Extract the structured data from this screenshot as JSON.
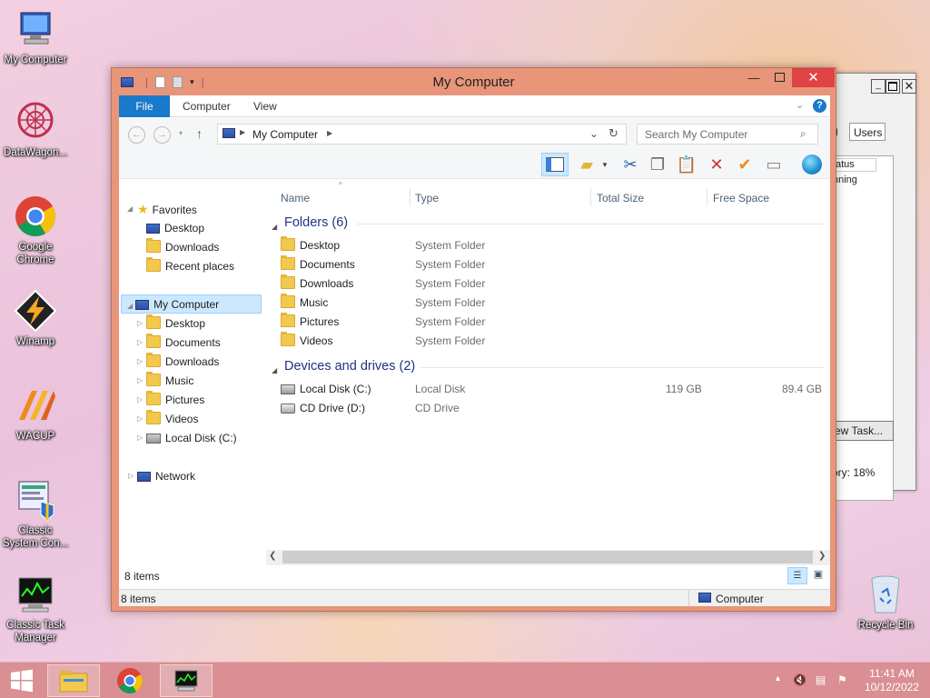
{
  "desktop": {
    "icons": [
      {
        "label": "My Computer",
        "icon": "computer-icon"
      },
      {
        "label": "DataWagon...",
        "icon": "datawagon-icon"
      },
      {
        "label": "Google Chrome",
        "icon": "chrome-icon"
      },
      {
        "label": "Winamp",
        "icon": "winamp-icon"
      },
      {
        "label": "WACUP",
        "icon": "wacup-icon"
      },
      {
        "label": "Classic System Con...",
        "icon": "system-control-icon"
      },
      {
        "label": "Classic Task Manager",
        "icon": "task-manager-icon"
      },
      {
        "label": "Recycle Bin",
        "icon": "recycle-bin-icon"
      }
    ]
  },
  "background_window": {
    "tab": "g",
    "tab_users": "Users",
    "col_status": "atus",
    "row_status": "nning",
    "button": "ew Task...",
    "footer": "ory: 18%"
  },
  "explorer": {
    "title": "My Computer",
    "ribbon_tabs": {
      "file": "File",
      "computer": "Computer",
      "view": "View"
    },
    "address": "My Computer",
    "search_placeholder": "Search My Computer",
    "nav": {
      "favorites": "Favorites",
      "fav_items": [
        "Desktop",
        "Downloads",
        "Recent places"
      ],
      "computer": "My Computer",
      "computer_items": [
        "Desktop",
        "Documents",
        "Downloads",
        "Music",
        "Pictures",
        "Videos",
        "Local Disk (C:)"
      ],
      "network": "Network"
    },
    "columns": {
      "name": "Name",
      "type": "Type",
      "total": "Total Size",
      "free": "Free Space"
    },
    "folders_group": "Folders (6)",
    "folders": [
      {
        "name": "Desktop",
        "type": "System Folder"
      },
      {
        "name": "Documents",
        "type": "System Folder"
      },
      {
        "name": "Downloads",
        "type": "System Folder"
      },
      {
        "name": "Music",
        "type": "System Folder"
      },
      {
        "name": "Pictures",
        "type": "System Folder"
      },
      {
        "name": "Videos",
        "type": "System Folder"
      }
    ],
    "devices_group": "Devices and drives (2)",
    "devices": [
      {
        "name": "Local Disk (C:)",
        "type": "Local Disk",
        "total": "119 GB",
        "free": "89.4 GB"
      },
      {
        "name": "CD Drive (D:)",
        "type": "CD Drive",
        "total": "",
        "free": ""
      }
    ],
    "item_count": "8 items",
    "status_count": "8 items",
    "status_location": "Computer"
  },
  "taskbar": {
    "time": "11:41 AM",
    "date": "10/12/2022",
    "tray_up": "▲"
  },
  "colors": {
    "accent": "#1979ca",
    "titlebar": "#e8957a",
    "taskbar": "#d98f93",
    "close": "#e04343"
  }
}
